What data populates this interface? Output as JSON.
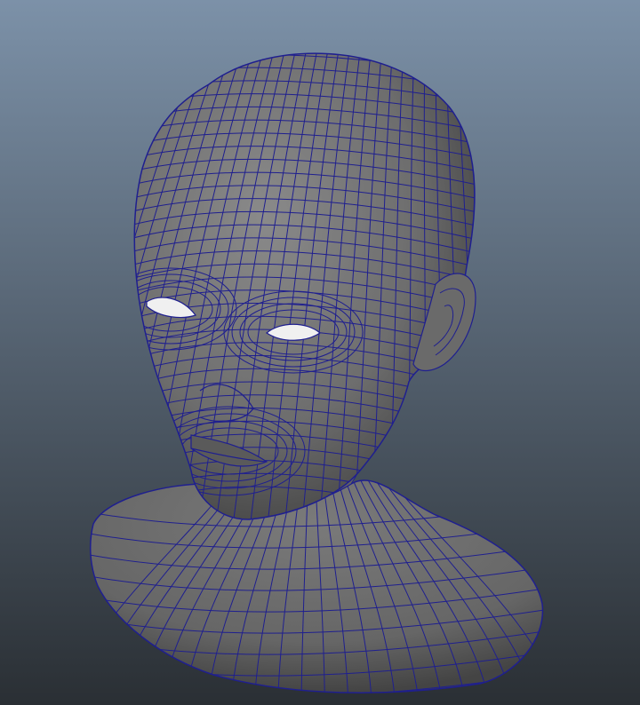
{
  "viewport": {
    "background_top": "#7c91a8",
    "background_bottom": "#2a2f34",
    "mesh_surface": "#6d6d6d",
    "mesh_surface_shadow": "#3c3c3c",
    "wireframe_color": "#1f1f8f",
    "model": "female-head-bust-wireframe-mesh"
  }
}
